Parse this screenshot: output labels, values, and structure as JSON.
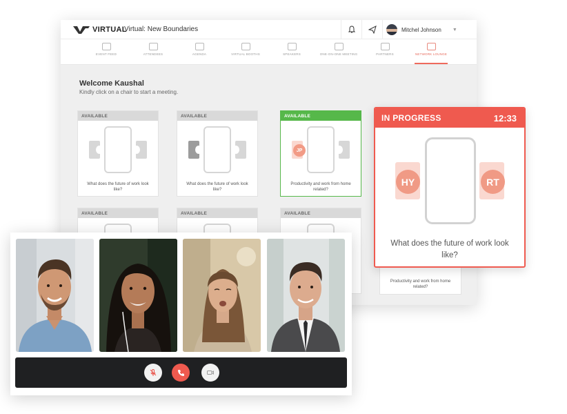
{
  "app": {
    "logo_text": "VIRTUAL",
    "event_title": "Virtual: New Boundaries",
    "user_name": "Mitchel Johnson"
  },
  "nav": {
    "items": [
      {
        "label": "EVENT FEED",
        "icon": "event-feed-icon"
      },
      {
        "label": "ATTENDEES",
        "icon": "attendees-icon"
      },
      {
        "label": "AGENDA",
        "icon": "agenda-icon"
      },
      {
        "label": "VIRTUAL BOOTHS",
        "icon": "virtual-booths-icon"
      },
      {
        "label": "SPEAKERS",
        "icon": "speakers-icon"
      },
      {
        "label": "ONE-ON-ONE MEETING",
        "icon": "meeting-icon"
      },
      {
        "label": "PARTNERS",
        "icon": "partners-icon"
      },
      {
        "label": "NETWORK LOUNGE",
        "icon": "lounge-icon",
        "active": true
      }
    ]
  },
  "lounge": {
    "welcome": "Welcome Kaushal",
    "instruction": "Kindly click on a chair to start a meeting.",
    "cards": [
      {
        "status": "AVAILABLE",
        "topic": "What does the future of work look like?"
      },
      {
        "status": "AVAILABLE",
        "topic": "What does the future of work look like?"
      },
      {
        "status": "AVAILABLE",
        "topic": "Productivity and work from home related?",
        "seated": "JP"
      },
      {
        "status": "AVAILABLE"
      },
      {
        "status": "AVAILABLE"
      },
      {
        "status": "AVAILABLE"
      }
    ],
    "hidden_card_topic": "Productivity and work from home related?"
  },
  "in_progress": {
    "status": "IN PROGRESS",
    "timer": "12:33",
    "left_initials": "HY",
    "right_initials": "RT",
    "topic": "What does the future of work look like?"
  },
  "video_call": {
    "participants": [
      "participant-1",
      "participant-2",
      "participant-3",
      "participant-4"
    ],
    "controls": [
      "mic-muted-icon",
      "end-call-icon",
      "camera-off-icon"
    ]
  },
  "colors": {
    "accent": "#ef5a4f",
    "available_green": "#56b84a",
    "avatar_salmon": "#f09a85",
    "control_bar": "#1f2022"
  }
}
